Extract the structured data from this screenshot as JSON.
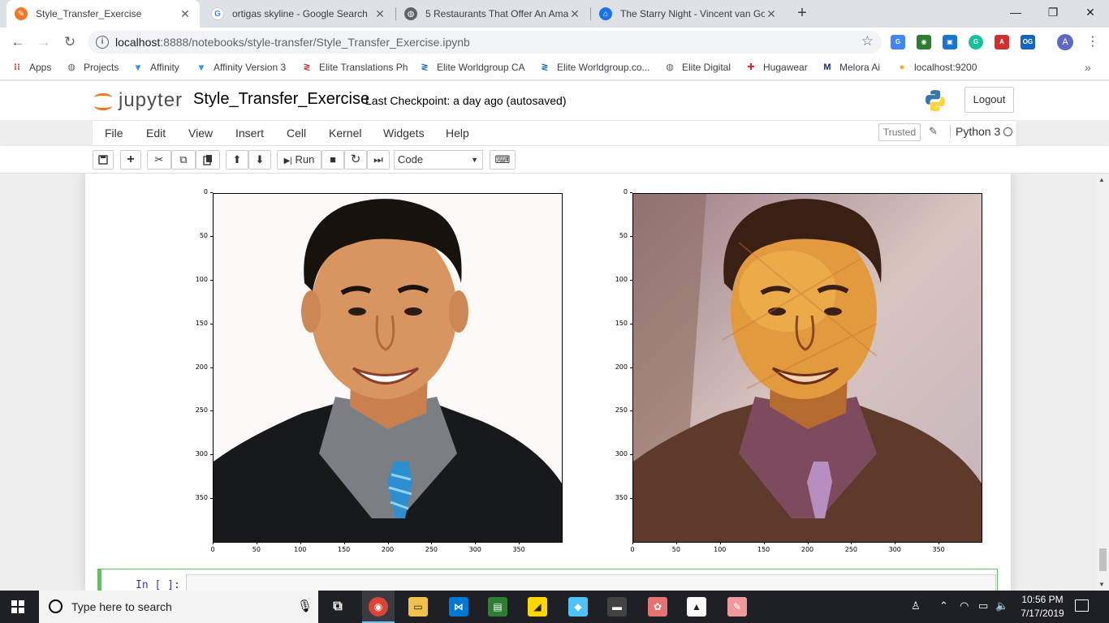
{
  "browser": {
    "tabs": [
      {
        "title": "Style_Transfer_Exercise",
        "active": true,
        "icon": "jupyter-tab-icon"
      },
      {
        "title": "ortigas skyline - Google Search",
        "active": false,
        "icon": "google-icon"
      },
      {
        "title": "5 Restaurants That Offer An Ama",
        "active": false,
        "icon": "globe-icon"
      },
      {
        "title": "The Starry Night - Vincent van Go",
        "active": false,
        "icon": "museum-icon"
      }
    ],
    "new_tab": "+",
    "window_controls": {
      "minimize": "—",
      "restore": "❐",
      "close": "✕"
    },
    "url_host": "localhost",
    "url_rest": ":8888/notebooks/style-transfer/Style_Transfer_Exercise.ipynb",
    "profile_initial": "A",
    "bookmarks": [
      {
        "label": "Apps",
        "icon": "apps-grid-icon"
      },
      {
        "label": "Projects",
        "icon": "globe-icon"
      },
      {
        "label": "Affinity",
        "icon": "affinity-icon"
      },
      {
        "label": "Affinity Version 3",
        "icon": "affinity-icon"
      },
      {
        "label": "Elite Translations Ph",
        "icon": "elite-icon"
      },
      {
        "label": "Elite Worldgroup CA",
        "icon": "elite-icon"
      },
      {
        "label": "Elite Worldgroup.co...",
        "icon": "elite-icon"
      },
      {
        "label": "Elite Digital",
        "icon": "globe-icon"
      },
      {
        "label": "Hugawear",
        "icon": "canada-flag-icon"
      },
      {
        "label": "Melora Ai",
        "icon": "melora-icon"
      },
      {
        "label": "localhost:9200",
        "icon": "elastic-icon"
      }
    ],
    "bookmarks_overflow": "»"
  },
  "jupyter": {
    "logo_text": "jupyter",
    "notebook_name": "Style_Transfer_Exercise",
    "checkpoint": "Last Checkpoint: a day ago  (autosaved)",
    "logout": "Logout",
    "menu": [
      "File",
      "Edit",
      "View",
      "Insert",
      "Cell",
      "Kernel",
      "Widgets",
      "Help"
    ],
    "trusted": "Trusted",
    "kernel": "Python 3",
    "toolbar": {
      "save": "💾",
      "add": "+",
      "cut": "✂",
      "copy": "⧉",
      "paste": "📋",
      "up": "⬆",
      "down": "⬇",
      "run": "Run",
      "stop": "■",
      "restart": "↻",
      "fast_forward": "⏭",
      "keyboard": "⌨"
    },
    "cell_type": "Code",
    "next_cell_prompt": "In [ ]:",
    "plots": {
      "y_ticks": [
        "0",
        "50",
        "100",
        "150",
        "200",
        "250",
        "300",
        "350"
      ],
      "x_ticks": [
        "0",
        "50",
        "100",
        "150",
        "200",
        "250",
        "300",
        "350"
      ],
      "x_range": [
        0,
        399
      ],
      "y_range": [
        0,
        399
      ]
    }
  },
  "taskbar": {
    "search_placeholder": "Type here to search",
    "time": "10:56 PM",
    "date": "7/17/2019"
  },
  "colors": {
    "jupyter_orange": "#f37726",
    "tab_strip": "#dee1e6",
    "taskbar": "#1f2025",
    "cell_active_border": "#66bb6a"
  }
}
